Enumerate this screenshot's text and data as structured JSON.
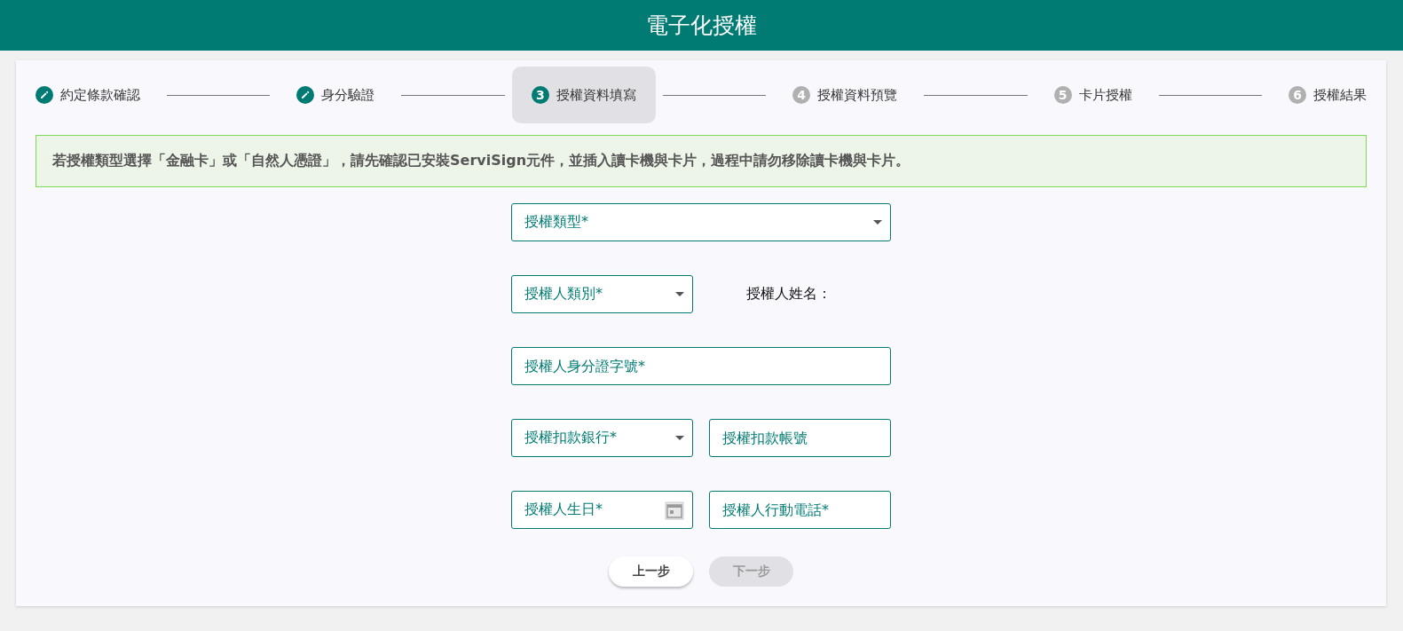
{
  "header": {
    "title": "電子化授權"
  },
  "steps": [
    {
      "label": "約定條款確認",
      "kind": "done",
      "selected": false
    },
    {
      "label": "身分驗證",
      "kind": "done",
      "selected": false
    },
    {
      "label": "授權資料填寫",
      "number": "3",
      "kind": "numbered",
      "selected": true
    },
    {
      "label": "授權資料預覽",
      "number": "4",
      "kind": "numbered",
      "selected": false
    },
    {
      "label": "卡片授權",
      "number": "5",
      "kind": "numbered",
      "selected": false
    },
    {
      "label": "授權結果",
      "number": "6",
      "kind": "numbered",
      "selected": false
    }
  ],
  "notice": "若授權類型選擇「金融卡」或「自然人憑證」，請先確認已安裝ServiSign元件，並插入讀卡機與卡片，過程中請勿移除讀卡機與卡片。",
  "form_rows": [
    [
      {
        "kind": "select",
        "placeholder": "授權類型*"
      }
    ],
    [
      {
        "kind": "select",
        "placeholder": "授權人類別*"
      },
      {
        "kind": "label",
        "text": "授權人姓名："
      }
    ],
    [
      {
        "kind": "text",
        "placeholder": "授權人身分證字號*"
      }
    ],
    [
      {
        "kind": "select",
        "placeholder": "授權扣款銀行*"
      },
      {
        "kind": "text",
        "placeholder": "授權扣款帳號"
      }
    ],
    [
      {
        "kind": "date",
        "placeholder": "授權人生日*"
      },
      {
        "kind": "text",
        "placeholder": "授權人行動電話*"
      }
    ]
  ],
  "buttons": [
    {
      "label": "上一步",
      "disabled": false
    },
    {
      "label": "下一步",
      "disabled": true
    }
  ]
}
